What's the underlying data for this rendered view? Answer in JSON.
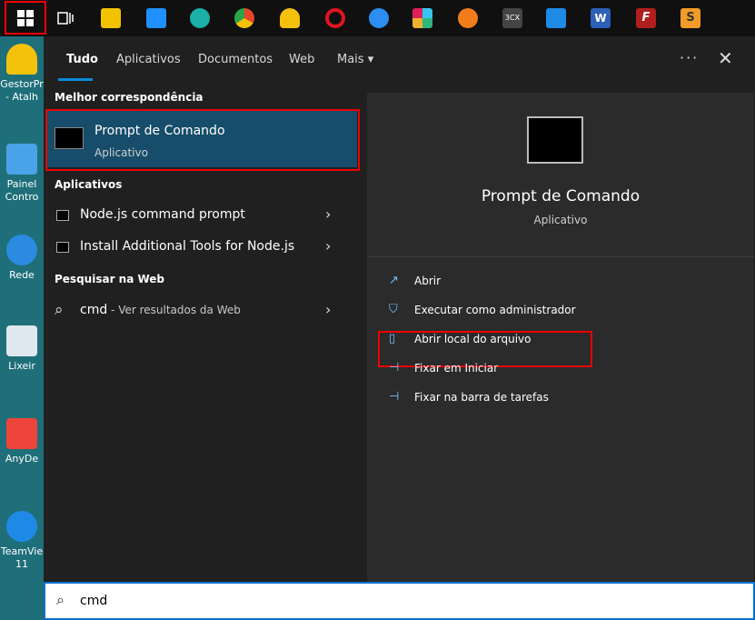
{
  "taskbar": {
    "icons": [
      {
        "name": "start-icon",
        "color": "#ffffff"
      },
      {
        "name": "task-view-icon",
        "color": "#ffffff"
      },
      {
        "name": "file-explorer-icon",
        "color": "#f2c200"
      },
      {
        "name": "mail-icon",
        "color": "#1e90ff"
      },
      {
        "name": "edge-icon",
        "color": "#1bb0a8"
      },
      {
        "name": "chrome-icon",
        "color": "#e8442c"
      },
      {
        "name": "helmet-icon",
        "color": "#f4c20d"
      },
      {
        "name": "opera-icon",
        "color": "#e0141e"
      },
      {
        "name": "paint-icon",
        "color": "#2b8ef0"
      },
      {
        "name": "slack-icon",
        "color": "#e01e5a"
      },
      {
        "name": "sync-icon",
        "color": "#f27c1a"
      },
      {
        "name": "3cx-icon",
        "color": "#555555"
      },
      {
        "name": "teamviewer-icon",
        "color": "#1e8ae6"
      },
      {
        "name": "word-icon",
        "color": "#2b5fb8"
      },
      {
        "name": "filezilla-icon",
        "color": "#b01e1e"
      },
      {
        "name": "sublime-icon",
        "color": "#f19b28"
      }
    ],
    "threecx_label": "3CX",
    "word_label": "W",
    "filezilla_label": "F",
    "sublime_label": "S"
  },
  "desktop": {
    "items": [
      {
        "label": "GestorPr - Atalh"
      },
      {
        "label": "Painel Contro"
      },
      {
        "label": "Rede"
      },
      {
        "label": "Lixeir"
      },
      {
        "label": "AnyDe"
      },
      {
        "label": "TeamVie 11"
      }
    ]
  },
  "tabs": {
    "items": [
      "Tudo",
      "Aplicativos",
      "Documentos",
      "Web",
      "Mais"
    ],
    "more_chevron": "▾",
    "dots": "···",
    "close": "✕"
  },
  "left": {
    "best_match_header": "Melhor correspondência",
    "best_match": {
      "title": "Prompt de Comando",
      "subtitle": "Aplicativo"
    },
    "apps_header": "Aplicativos",
    "apps": [
      {
        "label": "Node.js command prompt"
      },
      {
        "label": "Install Additional Tools for Node.js"
      }
    ],
    "web_header": "Pesquisar na Web",
    "web": {
      "query": "cmd",
      "suffix": " - Ver resultados da Web"
    },
    "chevron": "›"
  },
  "preview": {
    "title": "Prompt de Comando",
    "subtitle": "Aplicativo",
    "actions": [
      {
        "label": "Abrir",
        "icon": "open-icon",
        "glyph": "↗"
      },
      {
        "label": "Executar como administrador",
        "icon": "shield-icon",
        "glyph": "⛉"
      },
      {
        "label": "Abrir local do arquivo",
        "icon": "file-location-icon",
        "glyph": "▯"
      },
      {
        "label": "Fixar em Iniciar",
        "icon": "pin-icon",
        "glyph": "⊣"
      },
      {
        "label": "Fixar na barra de tarefas",
        "icon": "pin-taskbar-icon",
        "glyph": "⊣"
      }
    ]
  },
  "search": {
    "value": "cmd",
    "glyph": "⌕"
  }
}
